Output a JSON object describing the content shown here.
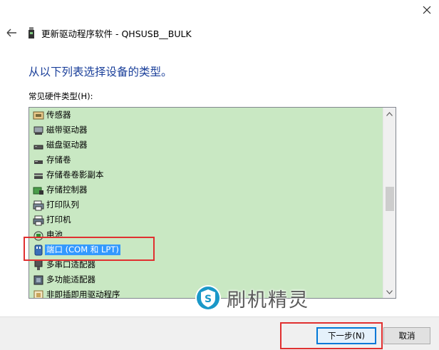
{
  "window": {
    "title": "更新驱动程序软件 - QHSUSB__BULK",
    "close_glyph": "✕",
    "back_glyph": "←"
  },
  "main": {
    "heading": "从以下列表选择设备的类型。",
    "list_label": "常见硬件类型(H):"
  },
  "hardware_list": {
    "items": [
      {
        "label": "传感器",
        "icon": "sensor-icon",
        "selected": false
      },
      {
        "label": "磁带驱动器",
        "icon": "tape-drive-icon",
        "selected": false
      },
      {
        "label": "磁盘驱动器",
        "icon": "disk-drive-icon",
        "selected": false
      },
      {
        "label": "存储卷",
        "icon": "storage-volume-icon",
        "selected": false
      },
      {
        "label": "存储卷卷影副本",
        "icon": "shadow-copy-icon",
        "selected": false
      },
      {
        "label": "存储控制器",
        "icon": "storage-controller-icon",
        "selected": false
      },
      {
        "label": "打印队列",
        "icon": "print-queue-icon",
        "selected": false
      },
      {
        "label": "打印机",
        "icon": "printer-icon",
        "selected": false
      },
      {
        "label": "电池",
        "icon": "battery-icon",
        "selected": false
      },
      {
        "label": "端口 (COM 和 LPT)",
        "icon": "port-icon",
        "selected": true
      },
      {
        "label": "多串口适配器",
        "icon": "multiport-serial-icon",
        "selected": false
      },
      {
        "label": "多功能适配器",
        "icon": "multifunction-adapter-icon",
        "selected": false
      },
      {
        "label": "非即插即用驱动程序",
        "icon": "non-pnp-driver-icon",
        "selected": false
      }
    ],
    "scroll_up_glyph": "▲",
    "scroll_down_glyph": "▼"
  },
  "footer": {
    "next_label": "下一步(N)",
    "cancel_label": "取消"
  },
  "watermark": {
    "text": "刷机精灵",
    "logo_letter": "S"
  },
  "colors": {
    "list_background": "#c9e8c3",
    "selection": "#3399ff",
    "heading": "#1a3f9a",
    "annotation_red": "#e03030",
    "watermark_logo": "#1a98c8"
  }
}
